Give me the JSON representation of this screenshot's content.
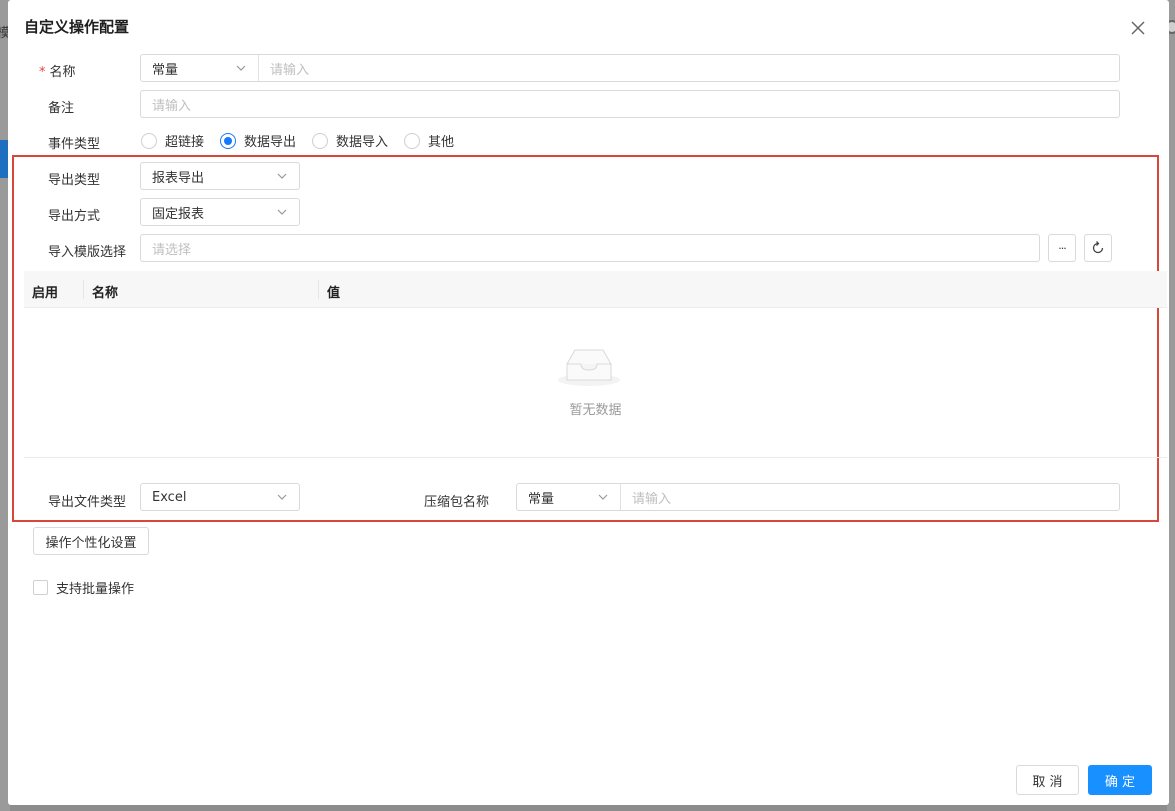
{
  "background": {
    "partial_text": "模"
  },
  "dialog": {
    "title": "自定义操作配置"
  },
  "form": {
    "name": {
      "label": "名称",
      "required_mark": "*",
      "type_value": "常量",
      "placeholder": "请输入"
    },
    "remark": {
      "label": "备注",
      "placeholder": "请输入"
    },
    "event_type": {
      "label": "事件类型",
      "options": [
        "超链接",
        "数据导出",
        "数据导入",
        "其他"
      ],
      "selected": "数据导出"
    },
    "export_type": {
      "label": "导出类型",
      "value": "报表导出"
    },
    "export_method": {
      "label": "导出方式",
      "value": "固定报表"
    },
    "import_template": {
      "label": "导入模版选择",
      "placeholder": "请选择",
      "more_icon": "···"
    },
    "table": {
      "columns": [
        "启用",
        "名称",
        "值"
      ],
      "empty_text": "暂无数据"
    },
    "export_file_type": {
      "label": "导出文件类型",
      "value": "Excel"
    },
    "zip_name": {
      "label": "压缩包名称",
      "type_value": "常量",
      "placeholder": "请输入"
    }
  },
  "personalize_button": "操作个性化设置",
  "batch_checkbox": {
    "label": "支持批量操作",
    "checked": false
  },
  "footer": {
    "cancel": "取 消",
    "confirm": "确 定"
  },
  "colors": {
    "primary": "#1890ff",
    "highlight_border": "#d9473b",
    "required": "#e54545"
  }
}
